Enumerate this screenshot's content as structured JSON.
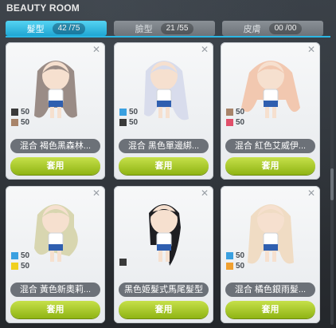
{
  "window": {
    "title": "BEAUTY ROOM"
  },
  "tabs": [
    {
      "label": "髮型",
      "count": "42 /75",
      "active": true
    },
    {
      "label": "臉型",
      "count": "21 /55",
      "active": false
    },
    {
      "label": "皮膚",
      "count": "00 /00",
      "active": false
    }
  ],
  "cards": [
    {
      "name": "混合 褐色黑森林...",
      "apply": "套用",
      "colors": [
        {
          "hex": "#3a3a3a",
          "pct": "50"
        },
        {
          "hex": "#a8846a",
          "pct": "50"
        }
      ],
      "hair": "#9a8c86"
    },
    {
      "name": "混合 黑色單邊綁...",
      "apply": "套用",
      "colors": [
        {
          "hex": "#3aa0e0",
          "pct": "50"
        },
        {
          "hex": "#3a3a3a",
          "pct": "50"
        }
      ],
      "hair": "#d8dcec"
    },
    {
      "name": "混合 紅色艾威伊...",
      "apply": "套用",
      "colors": [
        {
          "hex": "#a8846a",
          "pct": "50"
        },
        {
          "hex": "#e0506a",
          "pct": "50"
        }
      ],
      "hair": "#f2c8b0"
    },
    {
      "name": "混合 黃色新奧莉...",
      "apply": "套用",
      "colors": [
        {
          "hex": "#3aa0e0",
          "pct": "50"
        },
        {
          "hex": "#f0d020",
          "pct": "50"
        }
      ],
      "hair": "#d8d6b0"
    },
    {
      "name": "黑色姬髮式馬尾髮型",
      "apply": "套用",
      "colors": [
        {
          "hex": "#3a3a3a",
          "pct": ""
        }
      ],
      "hair": "#1e1e22"
    },
    {
      "name": "混合 橘色銀雨髮...",
      "apply": "套用",
      "colors": [
        {
          "hex": "#3aa0e0",
          "pct": "50"
        },
        {
          "hex": "#f0a030",
          "pct": "50"
        }
      ],
      "hair": "#f0dcc4"
    }
  ],
  "icons": {
    "close": "close-icon"
  },
  "colors": {
    "accent": "#2bb6e3",
    "apply_button": "#a8cc22",
    "name_pill": "#6c7178"
  }
}
